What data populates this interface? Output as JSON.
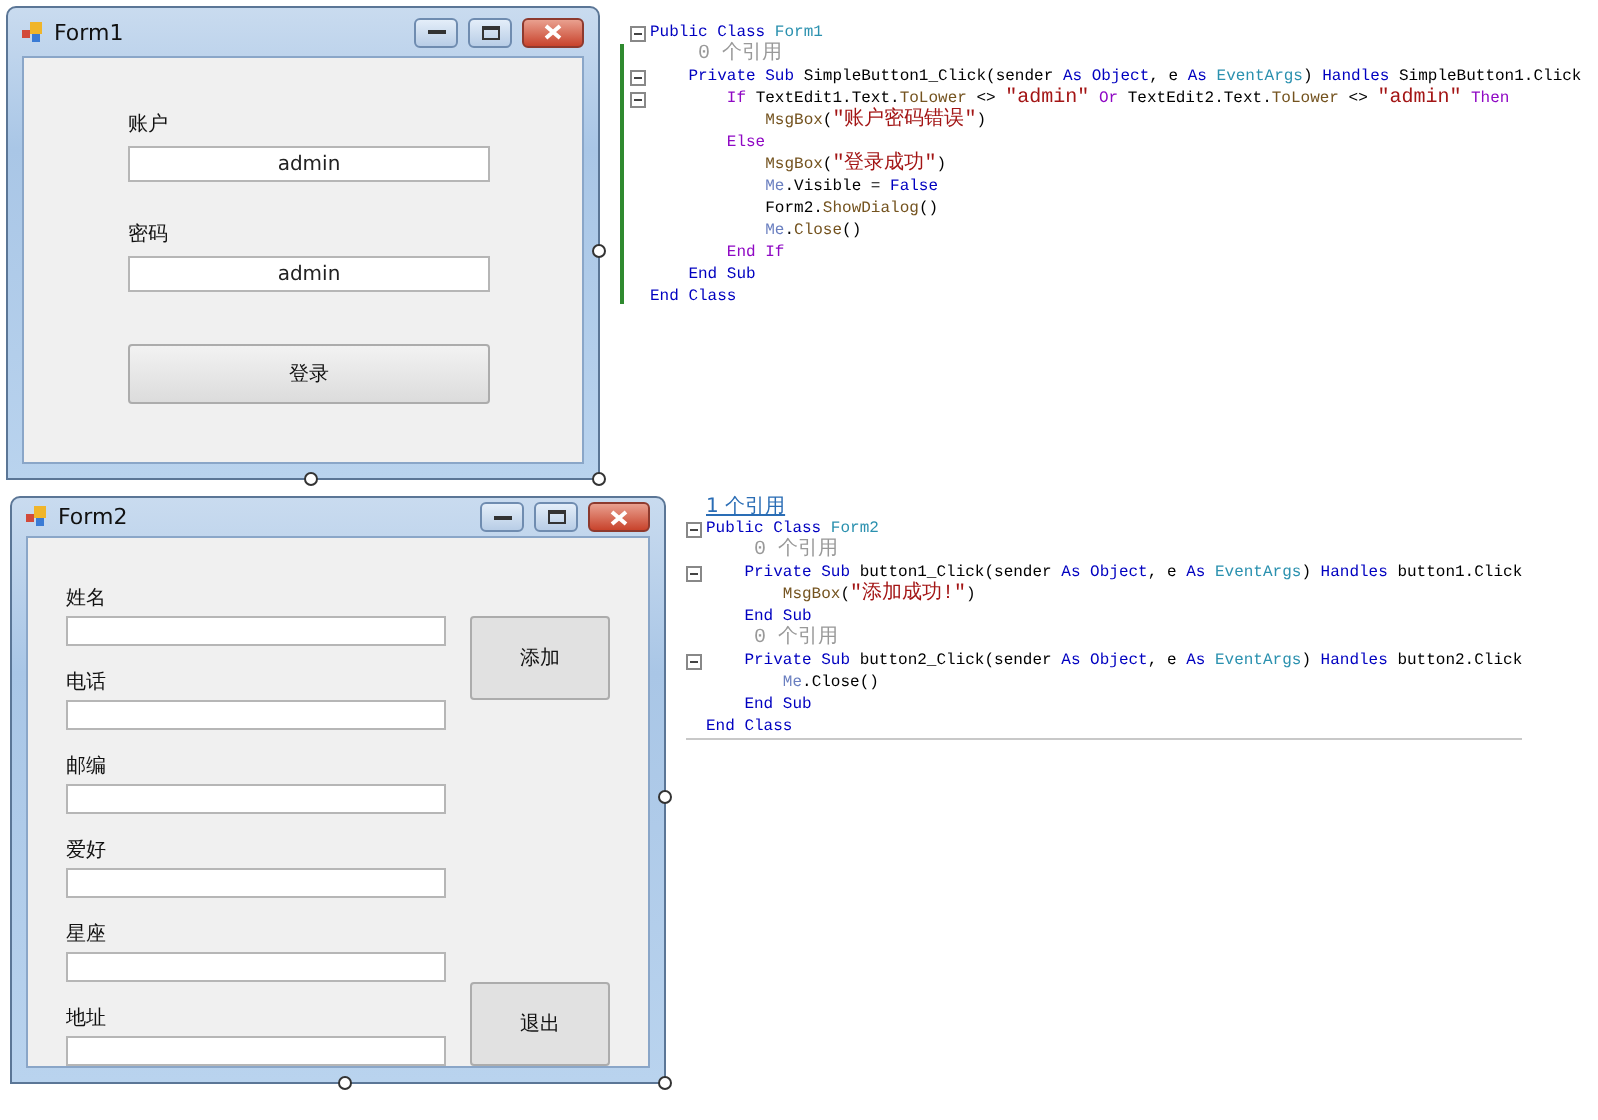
{
  "designs": [
    {
      "form": {
        "title": "Form1",
        "kind": "login",
        "fields": [
          {
            "label": "账户",
            "value": "admin"
          },
          {
            "label": "密码",
            "value": "admin"
          }
        ],
        "buttons": [
          "登录"
        ]
      },
      "code": {
        "change_marker": true,
        "lines": [
          {
            "fold": true,
            "tokens": [
              {
                "kind": "kw",
                "text": "Public Class "
              },
              {
                "kind": "type",
                "text": "Form1"
              }
            ]
          },
          {
            "fold": false,
            "tokens": [
              {
                "kind": "ref",
                "text": "    0 个引用"
              }
            ]
          },
          {
            "fold": true,
            "tokens": [
              {
                "kind": "kw",
                "text": "    Private Sub "
              },
              {
                "kind": "plain",
                "text": "SimpleButton1_Click(sender "
              },
              {
                "kind": "kw",
                "text": "As Object"
              },
              {
                "kind": "plain",
                "text": ", e "
              },
              {
                "kind": "kw",
                "text": "As "
              },
              {
                "kind": "type",
                "text": "EventArgs"
              },
              {
                "kind": "plain",
                "text": ") "
              },
              {
                "kind": "kw",
                "text": "Handles "
              },
              {
                "kind": "plain",
                "text": "SimpleButton1.Click"
              }
            ]
          },
          {
            "fold": true,
            "tokens": [
              {
                "kind": "ctl",
                "text": "        If "
              },
              {
                "kind": "plain",
                "text": "TextEdit1.Text."
              },
              {
                "kind": "method",
                "text": "ToLower"
              },
              {
                "kind": "plain",
                "text": " <> "
              },
              {
                "kind": "str",
                "text": "\"admin\""
              },
              {
                "kind": "ctl",
                "text": " Or "
              },
              {
                "kind": "plain",
                "text": "TextEdit2.Text."
              },
              {
                "kind": "method",
                "text": "ToLower"
              },
              {
                "kind": "plain",
                "text": " <> "
              },
              {
                "kind": "str",
                "text": "\"admin\""
              },
              {
                "kind": "ctl",
                "text": " Then"
              }
            ]
          },
          {
            "fold": false,
            "tokens": [
              {
                "kind": "method",
                "text": "            MsgBox"
              },
              {
                "kind": "plain",
                "text": "("
              },
              {
                "kind": "str",
                "text": "\"账户密码错误\""
              },
              {
                "kind": "plain",
                "text": ")"
              }
            ]
          },
          {
            "fold": false,
            "tokens": [
              {
                "kind": "ctl",
                "text": "        Else"
              }
            ]
          },
          {
            "fold": false,
            "tokens": [
              {
                "kind": "method",
                "text": "            MsgBox"
              },
              {
                "kind": "plain",
                "text": "("
              },
              {
                "kind": "str",
                "text": "\"登录成功\""
              },
              {
                "kind": "plain",
                "text": ")"
              }
            ]
          },
          {
            "fold": false,
            "tokens": [
              {
                "kind": "me",
                "text": "            Me"
              },
              {
                "kind": "plain",
                "text": ".Visible = "
              },
              {
                "kind": "kw",
                "text": "False"
              }
            ]
          },
          {
            "fold": false,
            "tokens": [
              {
                "kind": "plain",
                "text": "            Form2."
              },
              {
                "kind": "method",
                "text": "ShowDialog"
              },
              {
                "kind": "plain",
                "text": "()"
              }
            ]
          },
          {
            "fold": false,
            "tokens": [
              {
                "kind": "me",
                "text": "            Me"
              },
              {
                "kind": "plain",
                "text": "."
              },
              {
                "kind": "method",
                "text": "Close"
              },
              {
                "kind": "plain",
                "text": "()"
              }
            ]
          },
          {
            "fold": false,
            "tokens": [
              {
                "kind": "ctl",
                "text": "        End If"
              }
            ]
          },
          {
            "fold": false,
            "tokens": [
              {
                "kind": "kw",
                "text": "    End Sub"
              }
            ]
          },
          {
            "fold": false,
            "tokens": [
              {
                "kind": "kw",
                "text": "End Class"
              }
            ]
          }
        ]
      }
    },
    {
      "form": {
        "title": "Form2",
        "kind": "entry",
        "fields": [
          {
            "label": "姓名"
          },
          {
            "label": "电话"
          },
          {
            "label": "邮编"
          },
          {
            "label": "爱好"
          },
          {
            "label": "星座"
          },
          {
            "label": "地址"
          }
        ],
        "buttons": [
          "添加",
          "退出"
        ]
      },
      "code": {
        "change_marker": false,
        "header": "1 个引用",
        "lines": [
          {
            "fold": true,
            "tokens": [
              {
                "kind": "kw",
                "text": "Public Class "
              },
              {
                "kind": "type",
                "text": "Form2"
              }
            ]
          },
          {
            "fold": false,
            "tokens": [
              {
                "kind": "ref",
                "text": "    0 个引用"
              }
            ]
          },
          {
            "fold": true,
            "tokens": [
              {
                "kind": "kw",
                "text": "    Private Sub "
              },
              {
                "kind": "plain",
                "text": "button1_Click(sender "
              },
              {
                "kind": "kw",
                "text": "As Object"
              },
              {
                "kind": "plain",
                "text": ", e "
              },
              {
                "kind": "kw",
                "text": "As "
              },
              {
                "kind": "type",
                "text": "EventArgs"
              },
              {
                "kind": "plain",
                "text": ") "
              },
              {
                "kind": "kw",
                "text": "Handles "
              },
              {
                "kind": "plain",
                "text": "button1.Click"
              }
            ]
          },
          {
            "fold": false,
            "tokens": [
              {
                "kind": "method",
                "text": "        MsgBox"
              },
              {
                "kind": "plain",
                "text": "("
              },
              {
                "kind": "str",
                "text": "\"添加成功!\""
              },
              {
                "kind": "plain",
                "text": ")"
              }
            ]
          },
          {
            "fold": false,
            "tokens": [
              {
                "kind": "kw",
                "text": "    End Sub"
              }
            ]
          },
          {
            "fold": false,
            "tokens": [
              {
                "kind": "ref",
                "text": "    0 个引用"
              }
            ]
          },
          {
            "fold": true,
            "tokens": [
              {
                "kind": "kw",
                "text": "    Private Sub "
              },
              {
                "kind": "plain",
                "text": "button2_Click(sender "
              },
              {
                "kind": "kw",
                "text": "As Object"
              },
              {
                "kind": "plain",
                "text": ", e "
              },
              {
                "kind": "kw",
                "text": "As "
              },
              {
                "kind": "type",
                "text": "EventArgs"
              },
              {
                "kind": "plain",
                "text": ") "
              },
              {
                "kind": "kw",
                "text": "Handles "
              },
              {
                "kind": "plain",
                "text": "button2.Click"
              }
            ]
          },
          {
            "fold": false,
            "tokens": [
              {
                "kind": "me",
                "text": "        Me"
              },
              {
                "kind": "plain",
                "text": ".Close()"
              }
            ]
          },
          {
            "fold": false,
            "tokens": [
              {
                "kind": "kw",
                "text": "    End Sub"
              }
            ]
          },
          {
            "fold": false,
            "tokens": [
              {
                "kind": "kw",
                "text": "End Class"
              }
            ]
          }
        ]
      }
    }
  ]
}
